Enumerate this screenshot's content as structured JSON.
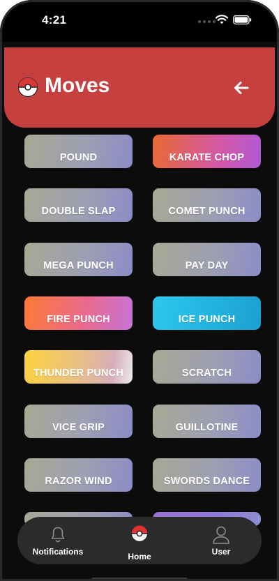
{
  "status_bar": {
    "time": "4:21"
  },
  "header": {
    "title": "Moves",
    "logo_icon": "pokeball-icon",
    "back_icon": "arrow-left-icon",
    "color": "#c6403f"
  },
  "moves": [
    {
      "name": "POUND",
      "type": "normal"
    },
    {
      "name": "KARATE CHOP",
      "type": "fighting"
    },
    {
      "name": "DOUBLE SLAP",
      "type": "normal"
    },
    {
      "name": "COMET PUNCH",
      "type": "normal"
    },
    {
      "name": "MEGA PUNCH",
      "type": "normal"
    },
    {
      "name": "PAY DAY",
      "type": "normal"
    },
    {
      "name": "FIRE PUNCH",
      "type": "fire"
    },
    {
      "name": "ICE PUNCH",
      "type": "ice"
    },
    {
      "name": "THUNDER PUNCH",
      "type": "electric"
    },
    {
      "name": "SCRATCH",
      "type": "normal"
    },
    {
      "name": "VICE GRIP",
      "type": "normal"
    },
    {
      "name": "GUILLOTINE",
      "type": "normal"
    },
    {
      "name": "RAZOR WIND",
      "type": "normal"
    },
    {
      "name": "SWORDS DANCE",
      "type": "normal"
    }
  ],
  "tabbar": {
    "items": [
      {
        "label": "Notifications",
        "icon": "bell-icon"
      },
      {
        "label": "Home",
        "icon": "pokeball-icon"
      },
      {
        "label": "User",
        "icon": "user-icon"
      }
    ]
  }
}
